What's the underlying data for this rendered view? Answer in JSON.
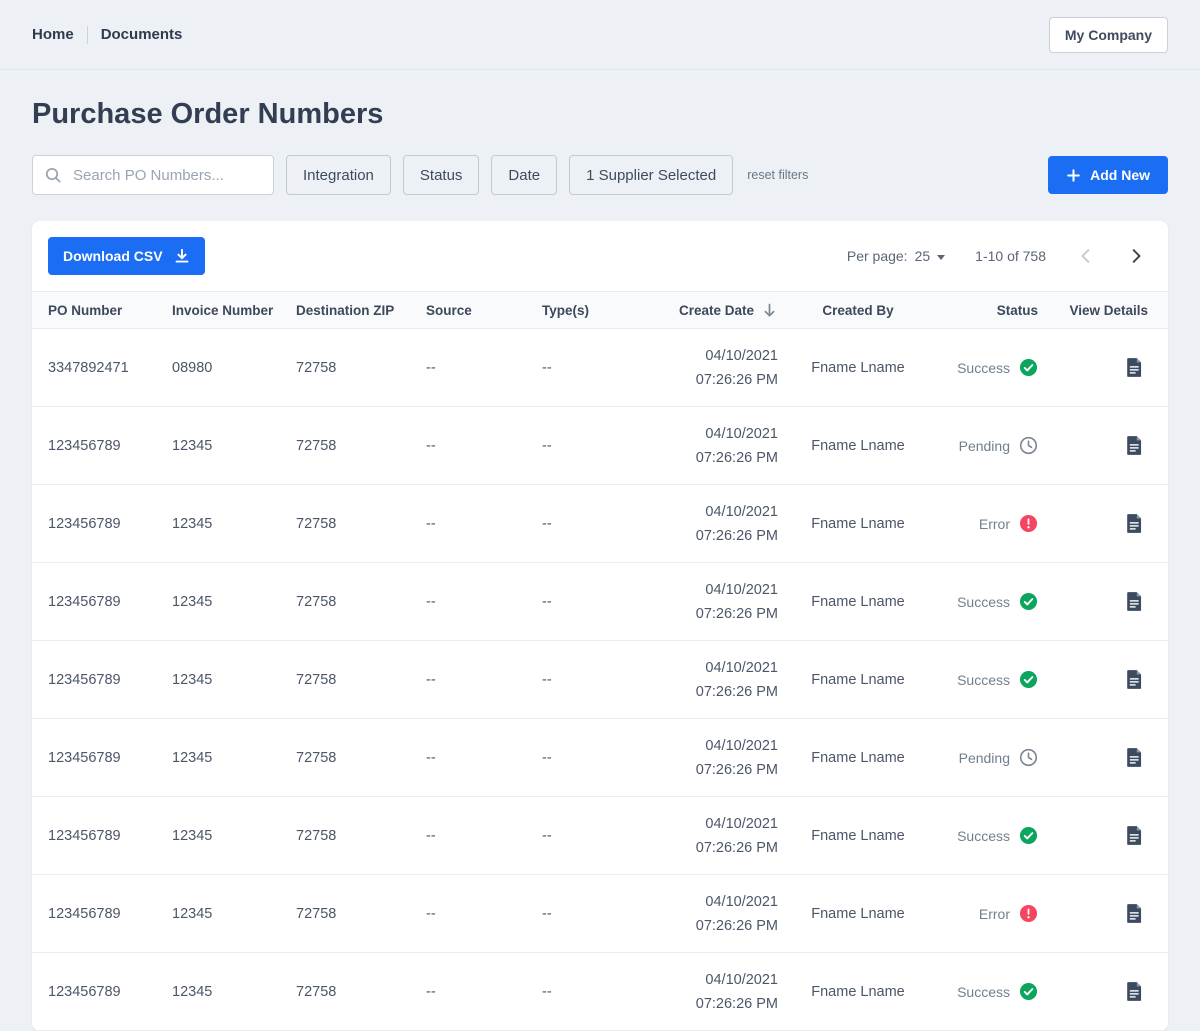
{
  "topbar": {
    "breadcrumb": [
      {
        "label": "Home"
      },
      {
        "label": "Documents"
      }
    ],
    "company_button": "My Company"
  },
  "page_title": "Purchase Order Numbers",
  "filters": {
    "search_placeholder": "Search PO Numbers...",
    "integration": "Integration",
    "status": "Status",
    "date": "Date",
    "supplier": "1 Supplier Selected",
    "reset": "reset filters",
    "add_new": "Add New"
  },
  "toolbar": {
    "download_csv": "Download CSV",
    "per_page_label": "Per page:",
    "per_page_value": "25",
    "range": "1-10 of 758"
  },
  "table": {
    "columns": [
      "PO Number",
      "Invoice Number",
      "Destination ZIP",
      "Source",
      "Type(s)",
      "Create Date",
      "Created By",
      "Status",
      "View Details"
    ],
    "sort_column": "Create Date",
    "sort_direction": "descending",
    "rows": [
      {
        "po": "3347892471",
        "invoice": "08980",
        "zip": "72758",
        "source": "--",
        "types": "--",
        "date": "04/10/2021",
        "time": "07:26:26 PM",
        "created_by": "Fname Lname",
        "status": "Success"
      },
      {
        "po": "123456789",
        "invoice": "12345",
        "zip": "72758",
        "source": "--",
        "types": "--",
        "date": "04/10/2021",
        "time": "07:26:26 PM",
        "created_by": "Fname Lname",
        "status": "Pending"
      },
      {
        "po": "123456789",
        "invoice": "12345",
        "zip": "72758",
        "source": "--",
        "types": "--",
        "date": "04/10/2021",
        "time": "07:26:26 PM",
        "created_by": "Fname Lname",
        "status": "Error"
      },
      {
        "po": "123456789",
        "invoice": "12345",
        "zip": "72758",
        "source": "--",
        "types": "--",
        "date": "04/10/2021",
        "time": "07:26:26 PM",
        "created_by": "Fname Lname",
        "status": "Success"
      },
      {
        "po": "123456789",
        "invoice": "12345",
        "zip": "72758",
        "source": "--",
        "types": "--",
        "date": "04/10/2021",
        "time": "07:26:26 PM",
        "created_by": "Fname Lname",
        "status": "Success"
      },
      {
        "po": "123456789",
        "invoice": "12345",
        "zip": "72758",
        "source": "--",
        "types": "--",
        "date": "04/10/2021",
        "time": "07:26:26 PM",
        "created_by": "Fname Lname",
        "status": "Pending"
      },
      {
        "po": "123456789",
        "invoice": "12345",
        "zip": "72758",
        "source": "--",
        "types": "--",
        "date": "04/10/2021",
        "time": "07:26:26 PM",
        "created_by": "Fname Lname",
        "status": "Success"
      },
      {
        "po": "123456789",
        "invoice": "12345",
        "zip": "72758",
        "source": "--",
        "types": "--",
        "date": "04/10/2021",
        "time": "07:26:26 PM",
        "created_by": "Fname Lname",
        "status": "Error"
      },
      {
        "po": "123456789",
        "invoice": "12345",
        "zip": "72758",
        "source": "--",
        "types": "--",
        "date": "04/10/2021",
        "time": "07:26:26 PM",
        "created_by": "Fname Lname",
        "status": "Success"
      }
    ]
  },
  "colors": {
    "accent_blue": "#1b6ef3",
    "success_green": "#0ca55e",
    "error_red": "#f54560",
    "pending_gray": "#7b8695",
    "page_background": "#edf1f6"
  }
}
